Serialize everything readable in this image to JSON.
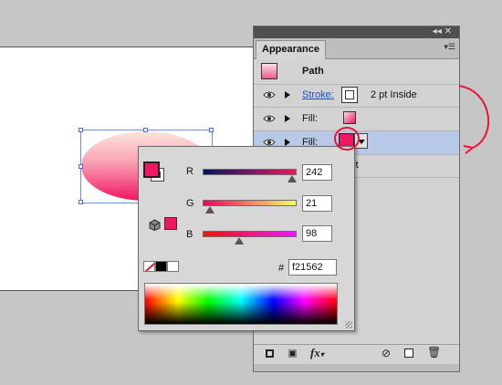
{
  "panel": {
    "title": "Appearance",
    "collapse_icon": "double-chevron-left",
    "menu_icon": "panel-menu",
    "object_label": "Path",
    "rows": [
      {
        "label": "Stroke:",
        "value": "2 pt  Inside"
      },
      {
        "label": "Fill:"
      },
      {
        "label": "Fill:"
      }
    ],
    "partial_text": "ault"
  },
  "picker": {
    "channels": [
      {
        "label": "R",
        "value": "242",
        "fraction": 0.949
      },
      {
        "label": "G",
        "value": "21",
        "fraction": 0.082
      },
      {
        "label": "B",
        "value": "98",
        "fraction": 0.384
      }
    ],
    "hex_label": "#",
    "hex_value": "f21562"
  },
  "colors": {
    "fill": "#f21562",
    "panel_bg": "#d3d3d3",
    "selected_row": "#b7c9e6",
    "annotation": "#e8143c"
  }
}
